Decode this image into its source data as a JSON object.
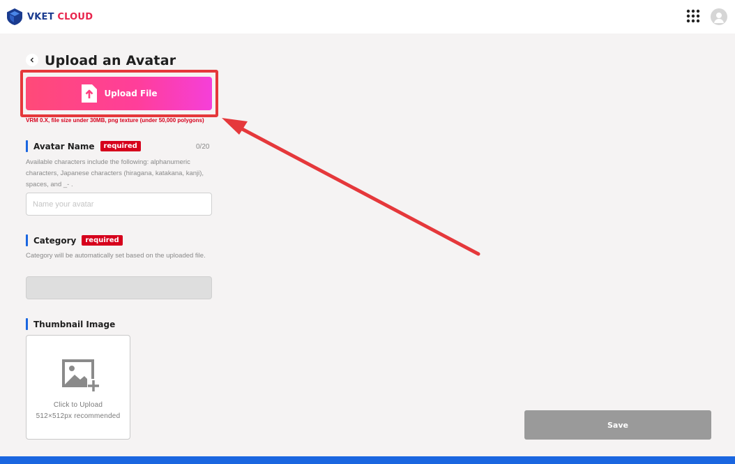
{
  "header": {
    "logo_part1": "VKET",
    "logo_part2": "CLOUD",
    "apps_icon": "grid-apps-icon",
    "avatar_icon": "user-avatar-icon"
  },
  "page": {
    "title": "Upload an Avatar"
  },
  "upload": {
    "button_label": "Upload File",
    "note": "VRM 0.X, file size under 30MB, png texture (under 50,000 polygons)"
  },
  "avatar_name": {
    "label": "Avatar Name",
    "badge": "required",
    "counter": "0/20",
    "help": "Available characters include the following: alphanumeric characters, Japanese characters (hiragana, katakana, kanji), spaces, and _- .",
    "placeholder": "Name your avatar",
    "value": ""
  },
  "category": {
    "label": "Category",
    "badge": "required",
    "help": "Category will be automatically set based on the uploaded file.",
    "value": ""
  },
  "thumbnail": {
    "label": "Thumbnail Image",
    "upload_text": "Click to Upload",
    "recommend_text": "512×512px recommended"
  },
  "actions": {
    "save_label": "Save"
  },
  "colors": {
    "brand_blue": "#1a66e0",
    "required_red": "#d6001c",
    "annotation_red": "#e5383b",
    "upload_gradient_start": "#ff4a78",
    "upload_gradient_end": "#f53fd9"
  }
}
